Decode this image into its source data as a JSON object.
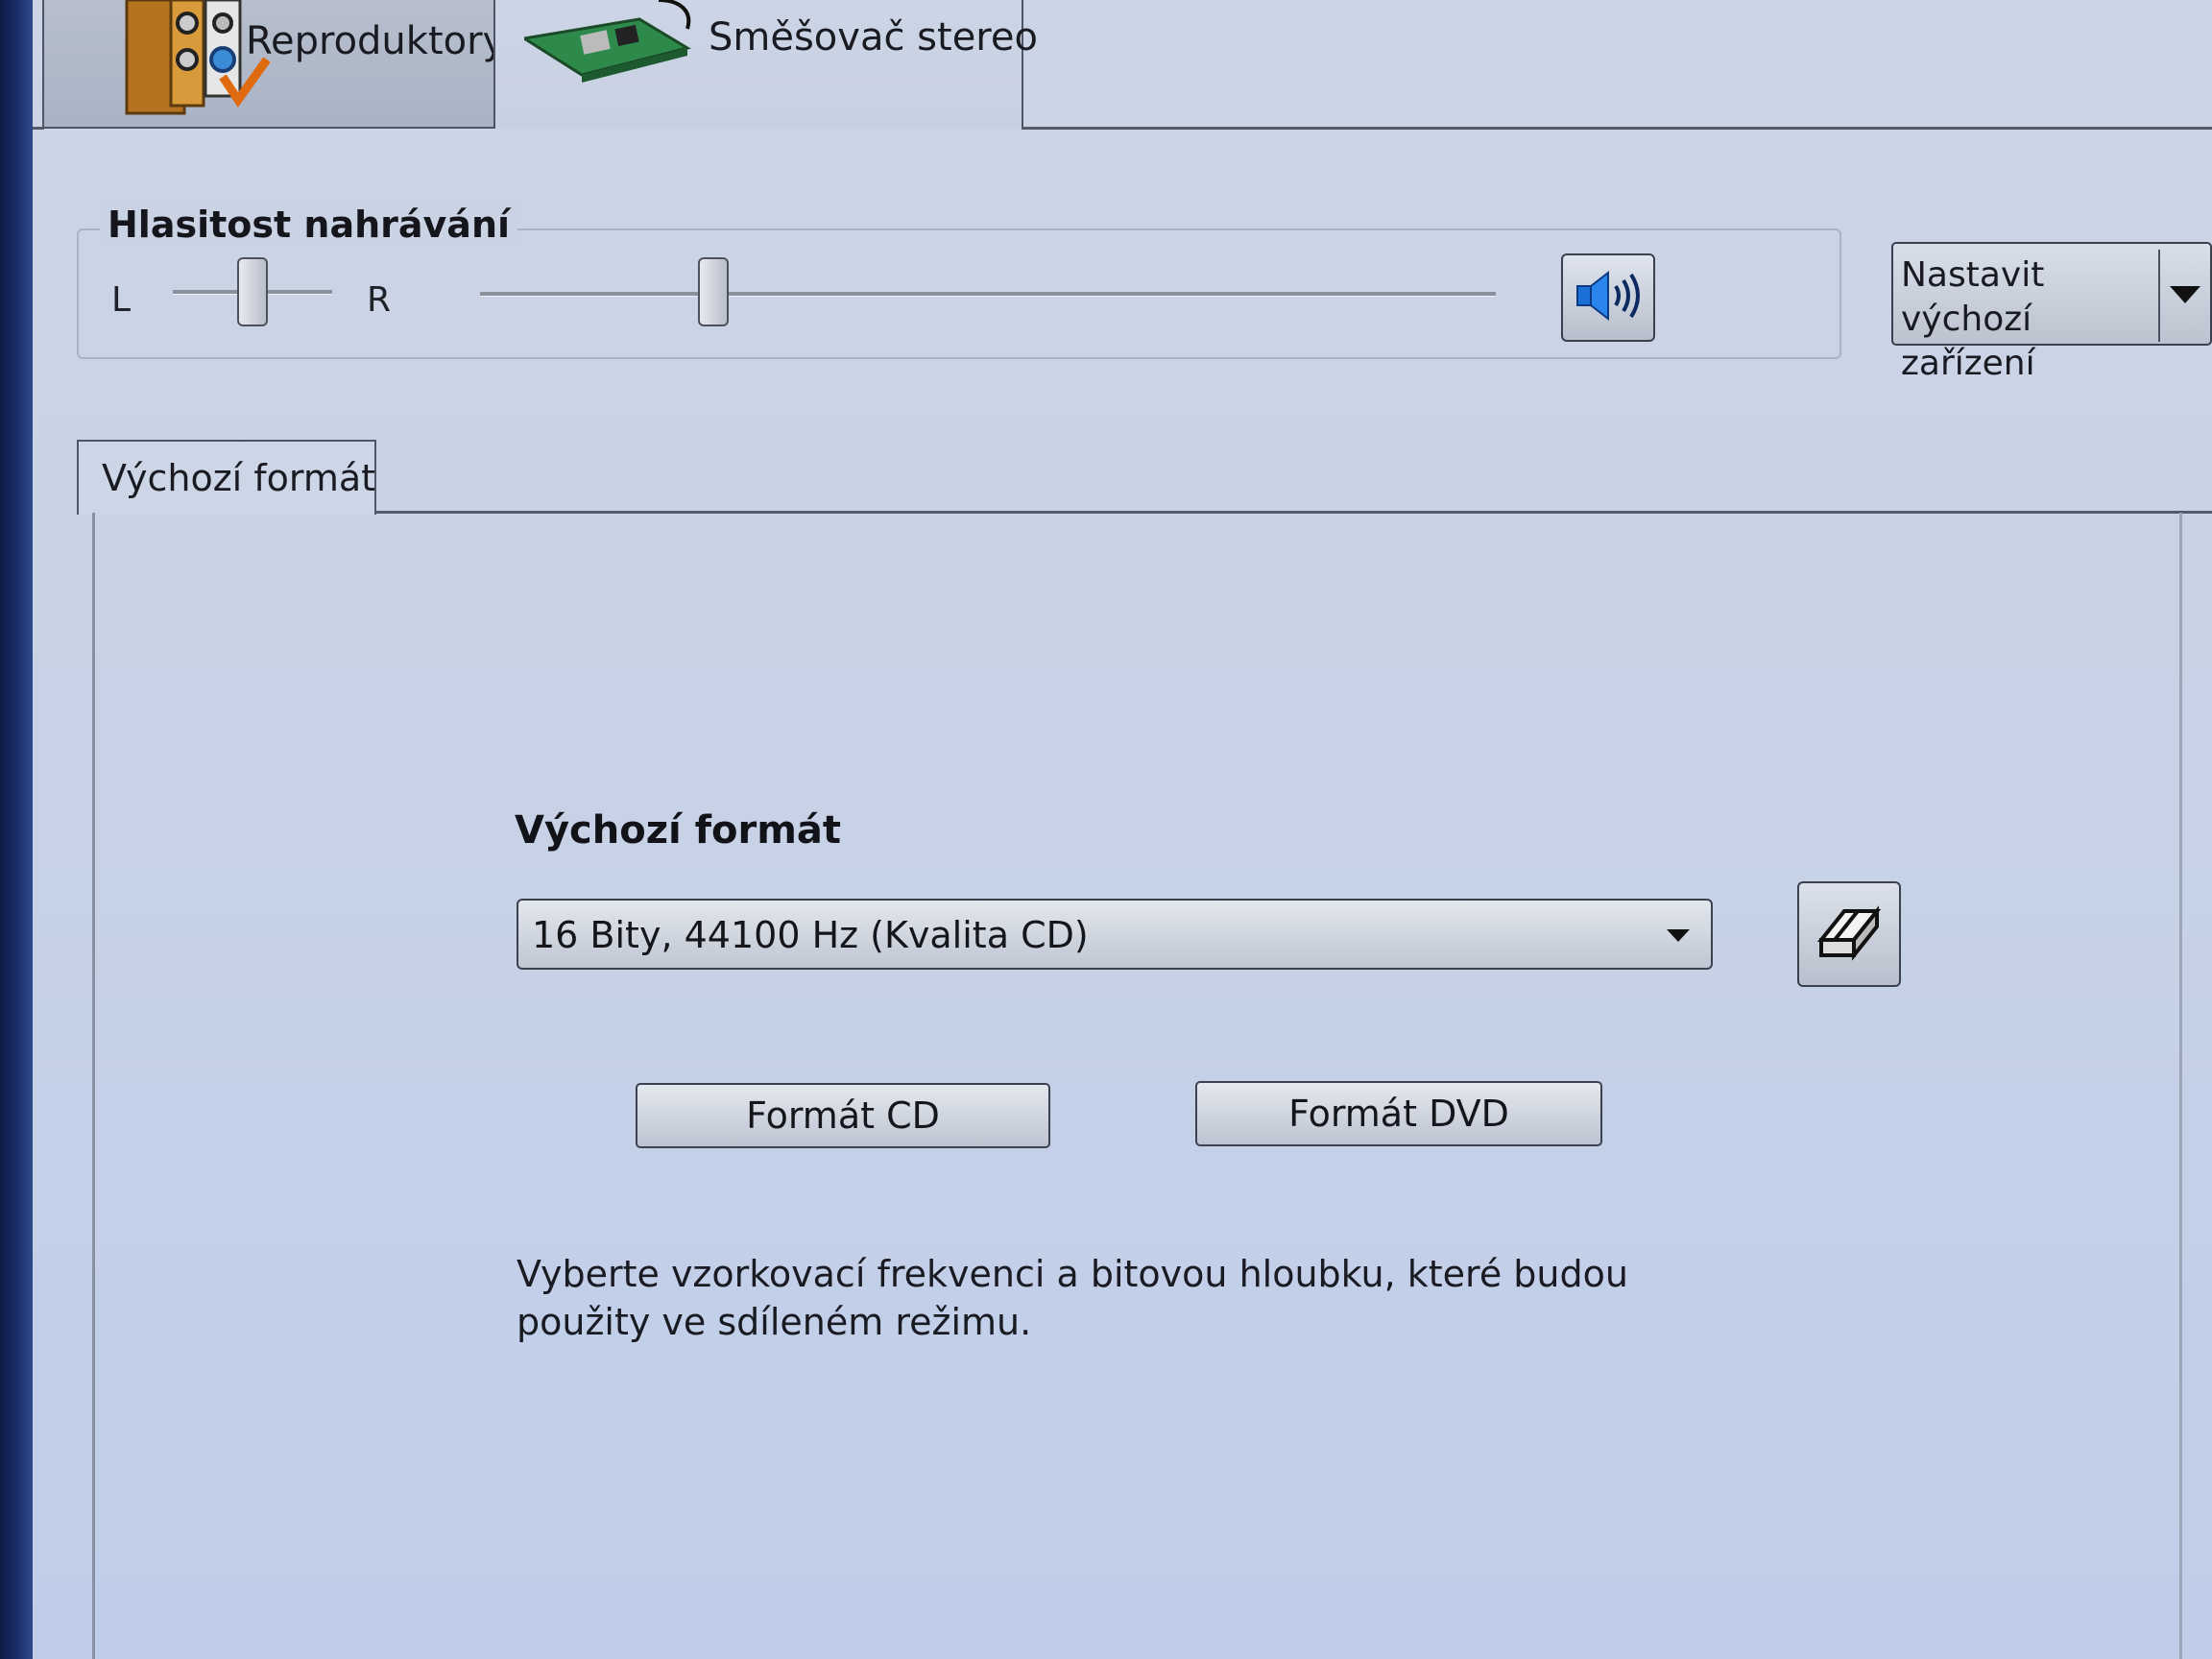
{
  "device_tabs": [
    {
      "label": "Reproduktory",
      "icon": "speakers-icon",
      "selected": false
    },
    {
      "label": "Směšovač stereo",
      "icon": "sound-card-icon",
      "selected": true
    }
  ],
  "recording_volume": {
    "title": "Hlasitost nahrávání",
    "balance_left_label": "L",
    "balance_right_label": "R",
    "balance_value": 0.5,
    "volume_value": 0.23,
    "mute_icon": "speaker-volume-icon"
  },
  "default_device": {
    "label": "Nastavit výchozí zařízení"
  },
  "inner_tabs": [
    {
      "label": "Výchozí formát",
      "selected": true
    }
  ],
  "default_format": {
    "heading": "Výchozí formát",
    "selected_value": "16 Bity, 44100 Hz (Kvalita CD)",
    "clear_icon": "eraser-icon",
    "cd_button": "Formát CD",
    "dvd_button": "Formát DVD",
    "description": "Vyberte vzorkovací frekvenci a bitovou hloubku, které budou použity ve sdíleném režimu."
  },
  "colors": {
    "background": "#c7d2e6",
    "border": "#3c4150",
    "accent_blue": "#1c6fd6"
  }
}
